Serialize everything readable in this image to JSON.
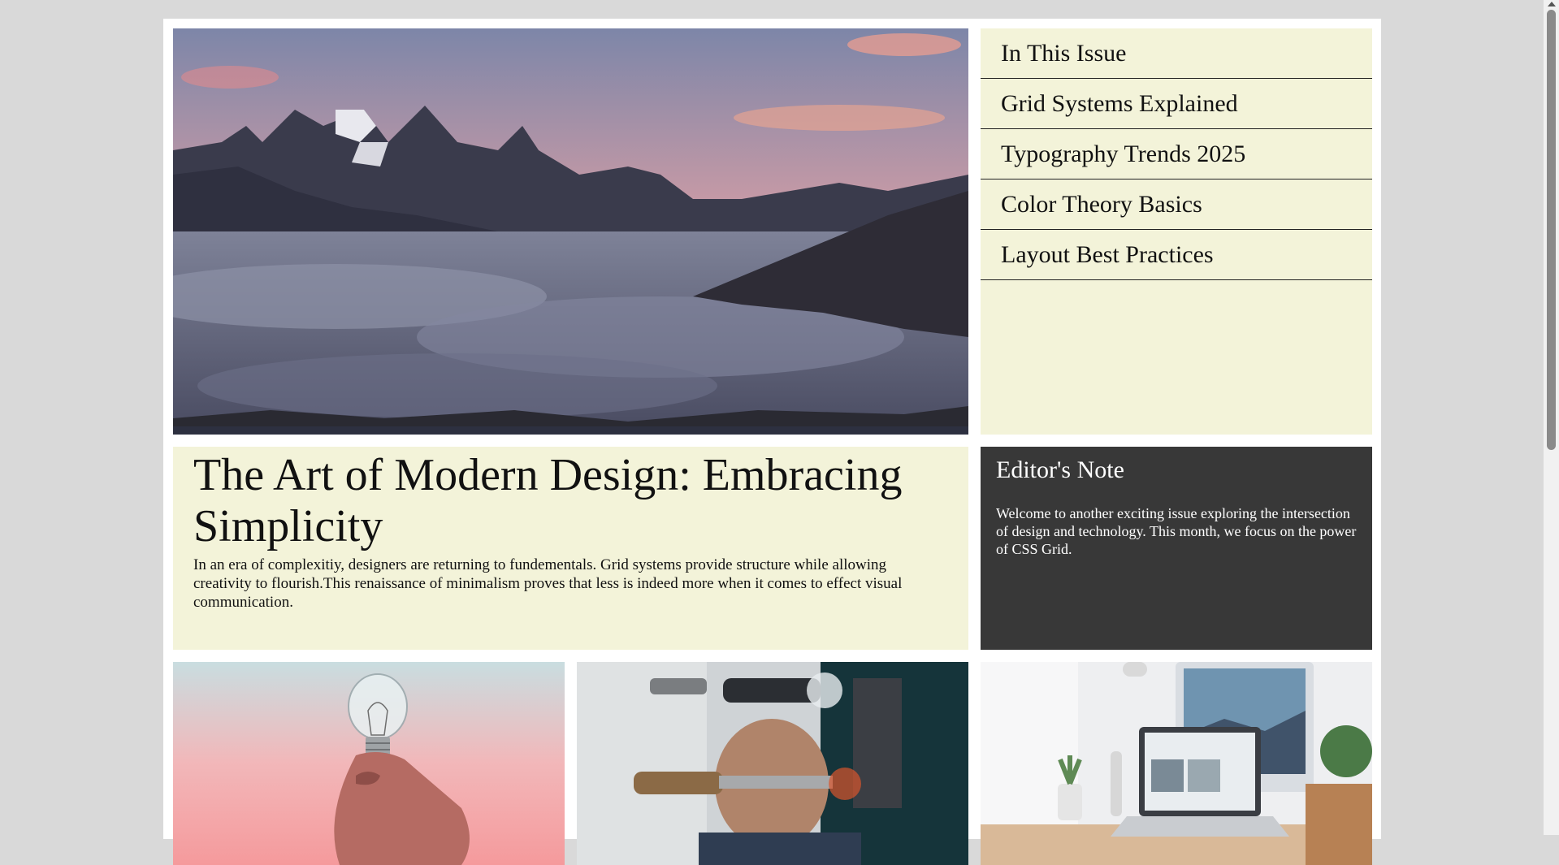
{
  "hero": {
    "image": "mountain-sunrise-above-clouds"
  },
  "issue": {
    "title": "In This Issue",
    "items": [
      "Grid Systems Explained",
      "Typography Trends 2025",
      "Color Theory Basics",
      "Layout Best Practices"
    ]
  },
  "feature": {
    "title": "The Art of Modern Design: Embracing Simplicity",
    "body": "In an era of complexitiy, designers are returning to fundementals. Grid systems provide structure while allowing creativity to flourish.This renaissance of minimalism proves that less is indeed more when it comes to effect visual communication."
  },
  "editor_note": {
    "title": "Editor's Note",
    "body": "Welcome to another exciting issue exploring the intersection of design and technology. This month, we focus on the power of CSS Grid."
  },
  "thumbnails": [
    {
      "image": "hand-holding-lightbulb"
    },
    {
      "image": "craftsman-with-tools"
    },
    {
      "image": "desk-with-laptop-and-monitor"
    }
  ],
  "colors": {
    "page_bg": "#d9d9d9",
    "panel_cream": "#f3f3d9",
    "panel_dark": "#383838"
  }
}
